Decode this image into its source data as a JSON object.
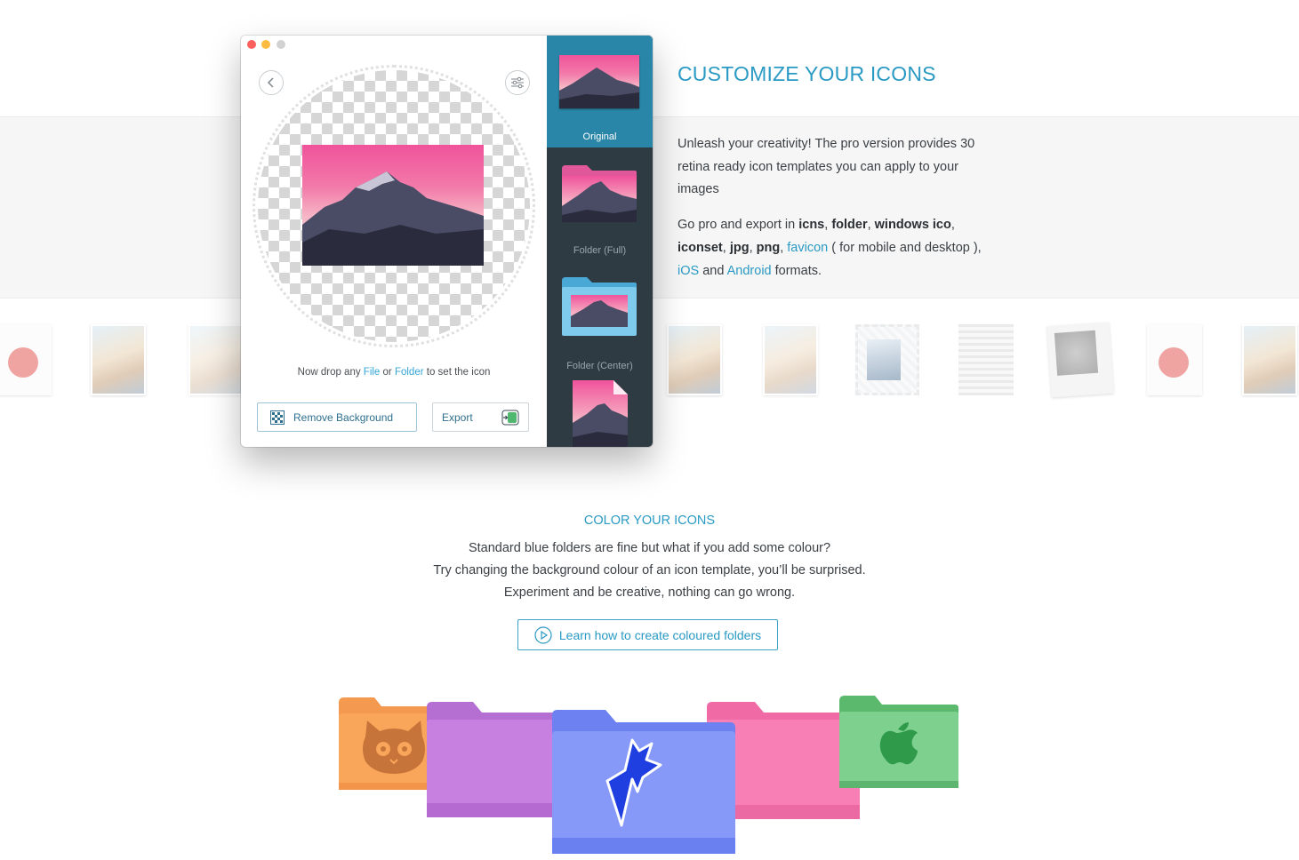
{
  "app": {
    "drop_hint_prefix": "Now drop any ",
    "drop_hint_file": "File",
    "drop_hint_or": " or ",
    "drop_hint_folder": "Folder",
    "drop_hint_suffix": " to set the icon",
    "remove_background_label": "Remove Background",
    "export_label": "Export",
    "templates": [
      {
        "label": "Original"
      },
      {
        "label": "Folder (Full)"
      },
      {
        "label": "Folder (Center)"
      }
    ]
  },
  "customize": {
    "title": "CUSTOMIZE YOUR ICONS",
    "intro": "Unleash your creativity! The pro version provides 30 retina ready icon templates you can apply to your images",
    "formats": {
      "prefix": "Go pro and export in ",
      "icns": "icns",
      "sep1": ", ",
      "folder": "folder",
      "sep2": ", ",
      "windows_ico": "windows ico",
      "sep3": ", ",
      "iconset": "iconset",
      "sep4": ", ",
      "jpg": "jpg",
      "sep5": ", ",
      "png": "png",
      "sep6": ", ",
      "favicon": "favicon",
      "favicon_note": " ( for mobile and desktop ), ",
      "ios": "iOS",
      "and": " and ",
      "android": "Android",
      "suffix": " formats."
    }
  },
  "color_section": {
    "title": "COLOR YOUR ICONS",
    "line1": "Standard blue folders are fine but what if you add some colour?",
    "line2": "Try changing the background colour of an icon template, you’ll be surprised.",
    "line3": "Experiment and be creative, nothing can go wrong.",
    "button_label": "Learn how to create coloured folders"
  },
  "colors": {
    "accent": "#2a9ac4",
    "panel_dark": "#2f3b43",
    "panel_selected": "#2a86a8",
    "folder_orange": "#f9a65a",
    "folder_purple": "#c77fe0",
    "folder_blue": "#7f93f7",
    "folder_pink": "#f77fb5",
    "folder_green": "#67c67a"
  },
  "icons": {
    "back": "chevron-left-icon",
    "settings": "sliders-icon",
    "remove_background": "checker-icon",
    "export": "export-icon",
    "play": "play-circle-icon",
    "cat": "cat-icon",
    "bolt": "bolt-logo-icon",
    "apple": "apple-icon"
  }
}
